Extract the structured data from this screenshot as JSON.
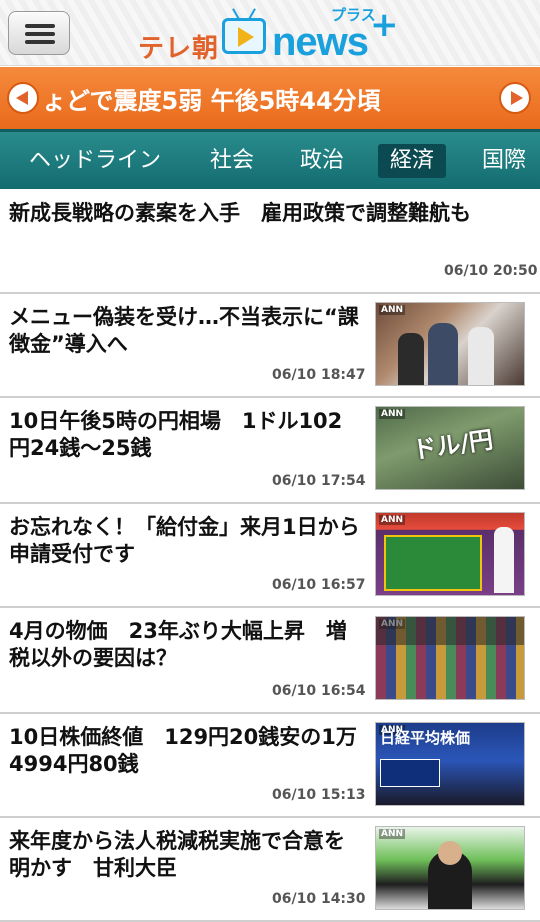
{
  "header": {
    "menu_label": "",
    "logo": {
      "tere": "テレ朝",
      "news": "news",
      "plus_text": "プラス",
      "plus_mark": "+"
    }
  },
  "ticker": {
    "text": "ょどで震度5弱 午後5時44分頃"
  },
  "tabs": [
    {
      "label": "ヘッドライン",
      "active": false
    },
    {
      "label": "社会",
      "active": false
    },
    {
      "label": "政治",
      "active": false
    },
    {
      "label": "経済",
      "active": true
    },
    {
      "label": "国際",
      "active": false
    }
  ],
  "items": [
    {
      "headline": "新成長戦略の素案を入手　雇用政策で調整難航も",
      "time": "06/10 20:50",
      "thumbnail": ""
    },
    {
      "headline": "メニュー偽装を受け…不当表示に“課徴金”導入へ",
      "time": "06/10 18:47",
      "thumbnail": ""
    },
    {
      "headline": "10日午後5時の円相場　1ドル102円24銭～25銭",
      "time": "06/10 17:54",
      "thumbnail": "ドル/円"
    },
    {
      "headline": "お忘れなく！「給付金」来月1日から申請受付です",
      "time": "06/10 16:57",
      "thumbnail": ""
    },
    {
      "headline": "4月の物価　23年ぶり大幅上昇　増税以外の要因は？",
      "time": "06/10 16:54",
      "thumbnail": ""
    },
    {
      "headline": "10日株価終値　129円20銭安の1万4994円80銭",
      "time": "06/10 15:13",
      "thumbnail": "日経平均株価"
    },
    {
      "headline": "来年度から法人税減税実施で合意を明かす　甘利大臣",
      "time": "06/10 14:30",
      "thumbnail": ""
    }
  ],
  "colors": {
    "ticker_bg": "#ea6a1c",
    "tabs_bg": "#1b7a7e",
    "tab_active": "#0a4a50",
    "logo_blue": "#1aa0dc",
    "logo_orange": "#e2622b"
  }
}
